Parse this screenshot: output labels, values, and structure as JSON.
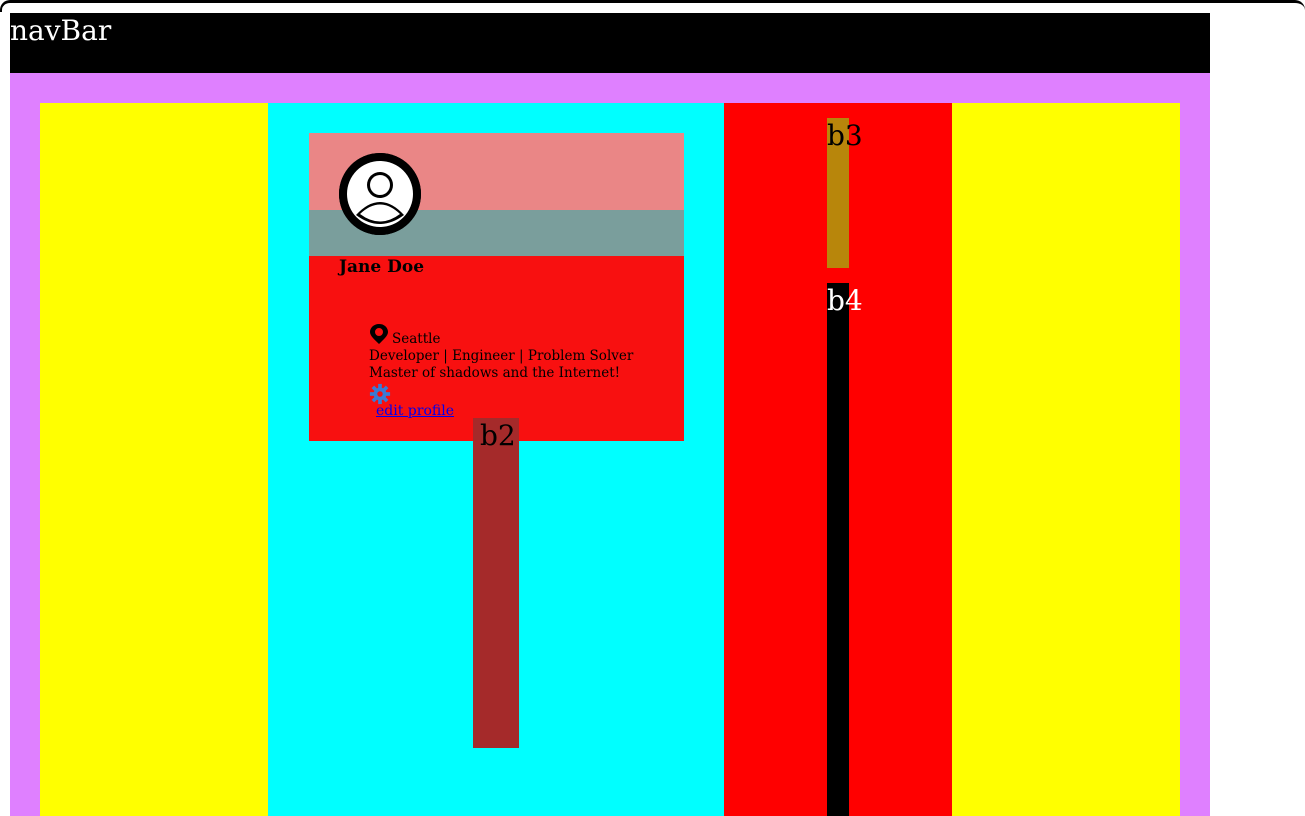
{
  "navbar": {
    "title": "navBar"
  },
  "colors": {
    "navbar_bg": "#000000",
    "navbar_text": "#ffffff",
    "outer_bg": "#df80ff",
    "left_col": "#ffff00",
    "center_col": "#00ffff",
    "right_col": "#ff0000",
    "far_right_col": "#ffff00",
    "card_top": "#ea8686",
    "card_mid": "#7a9e9c",
    "card_body": "#f81010",
    "b2_bg": "#a52a2a",
    "b3_bg": "#b8860b",
    "b4_bg": "#000000",
    "b4_text": "#ffffff",
    "gear": "#3a7bd5"
  },
  "card": {
    "avatar_icon": "user-avatar-icon",
    "name": "Jane Doe",
    "location_icon": "map-pin-icon",
    "location": "Seattle",
    "roles": "Developer | Engineer | Problem Solver",
    "bio": "Master of shadows and the Internet!",
    "settings_icon": "gear-icon",
    "edit_link": "edit profile"
  },
  "boxes": {
    "b2": "b2",
    "b3": "b3",
    "b4": "b4"
  }
}
